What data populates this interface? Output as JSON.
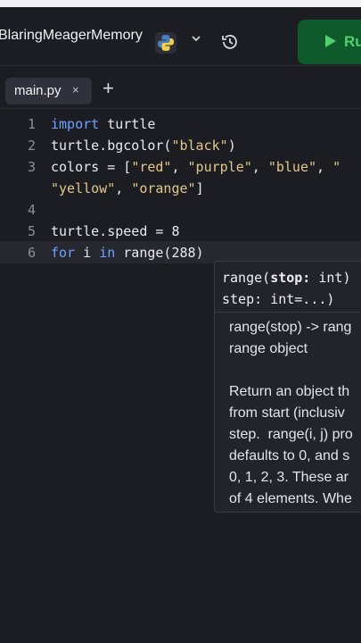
{
  "header": {
    "repl_name": "BlaringMeagerMemory",
    "run_label": "Ru",
    "language_icon": "python-logo-icon",
    "dropdown_icon": "chevron-down-icon",
    "history_icon": "history-icon",
    "run_icon": "play-icon"
  },
  "tabs": {
    "file_name": "main.py",
    "close_symbol": "×",
    "add_symbol": "+"
  },
  "editor": {
    "line_numbers": [
      "1",
      "2",
      "3",
      "",
      "4",
      "5",
      "6"
    ],
    "lines": [
      {
        "parts": [
          {
            "t": "import",
            "c": "kw"
          },
          {
            "t": " turtle",
            "c": ""
          }
        ]
      },
      {
        "parts": [
          {
            "t": "turtle.bgcolor(",
            "c": ""
          },
          {
            "t": "\"black\"",
            "c": "str"
          },
          {
            "t": ")",
            "c": ""
          }
        ]
      },
      {
        "parts": [
          {
            "t": "colors = [",
            "c": ""
          },
          {
            "t": "\"red\"",
            "c": "str"
          },
          {
            "t": ", ",
            "c": ""
          },
          {
            "t": "\"purple\"",
            "c": "str"
          },
          {
            "t": ", ",
            "c": ""
          },
          {
            "t": "\"blue\"",
            "c": "str"
          },
          {
            "t": ", ",
            "c": ""
          },
          {
            "t": "\"",
            "c": "str"
          }
        ]
      },
      {
        "parts": [
          {
            "t": "\"yellow\"",
            "c": "str"
          },
          {
            "t": ", ",
            "c": ""
          },
          {
            "t": "\"orange\"",
            "c": "str"
          },
          {
            "t": "]",
            "c": ""
          }
        ]
      },
      {
        "parts": []
      },
      {
        "parts": [
          {
            "t": "turtle.speed = 8",
            "c": ""
          }
        ]
      },
      {
        "parts": [
          {
            "t": "for",
            "c": "kw"
          },
          {
            "t": " i ",
            "c": ""
          },
          {
            "t": "in",
            "c": "kw"
          },
          {
            "t": " range(288)",
            "c": ""
          }
        ]
      }
    ]
  },
  "tooltip": {
    "signature_line1_a": "range(",
    "signature_line1_b": "stop:",
    "signature_line1_c": " int)",
    "signature_line2": "step: int=...)",
    "doc_lines": [
      "range(stop) -> rang",
      "range object",
      "",
      "Return an object th",
      "from start (inclusiv",
      "step.  range(i, j) pro",
      "defaults to 0, and s",
      "0, 1, 2, 3. These ar",
      "of 4 elements. Whe"
    ]
  }
}
